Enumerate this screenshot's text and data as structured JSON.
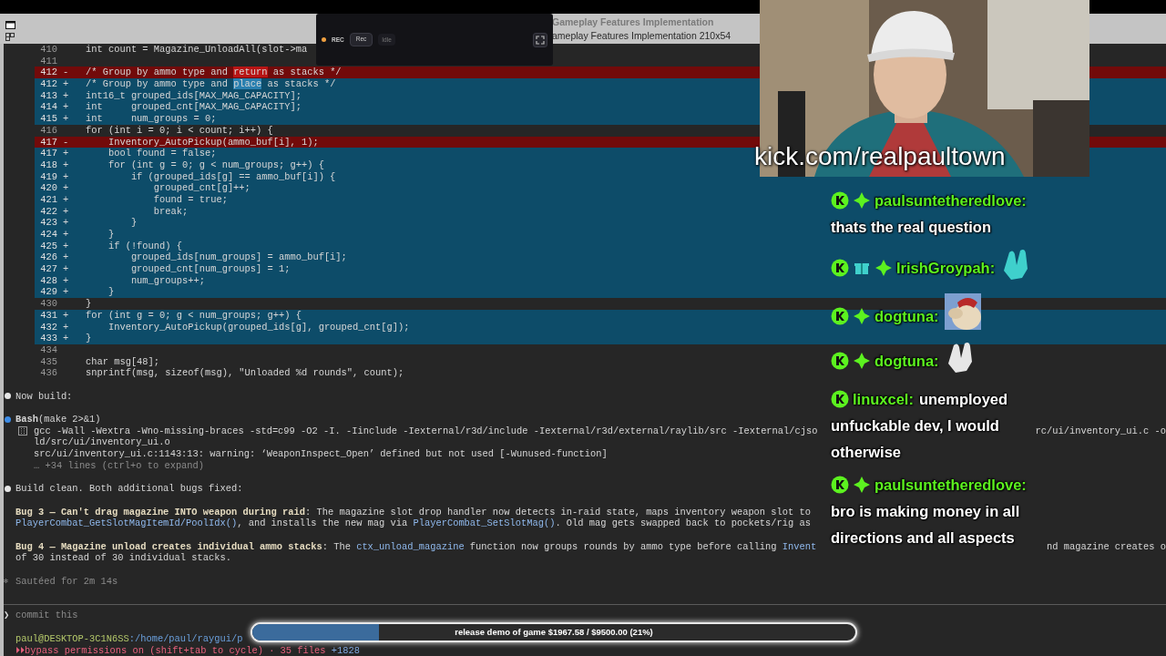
{
  "window": {
    "title_lines": [
      "Gameplay Features Implementation",
      "ameplay Features Implementation 210x54"
    ]
  },
  "recorder": {
    "status": "REC",
    "button": "Rec",
    "state": "Idle"
  },
  "diff": [
    {
      "number": "410",
      "kind": "context",
      "code": "int count = Magazine_UnloadAll(slot->ma"
    },
    {
      "number": "411",
      "kind": "context"
    },
    {
      "number": "412",
      "kind": "removed",
      "sign": "-",
      "segments": [
        {
          "text": "/* Group by ammo type and ",
          "highlight": false
        },
        {
          "text": "return",
          "highlight": true
        },
        {
          "text": " as stacks */",
          "highlight": false
        }
      ]
    },
    {
      "number": "412",
      "kind": "added",
      "sign": "+",
      "segments": [
        {
          "text": "/* Group by ammo type and ",
          "highlight": false
        },
        {
          "text": "place",
          "highlight": true
        },
        {
          "text": " as stacks */",
          "highlight": false
        }
      ]
    },
    {
      "number": "413",
      "kind": "added",
      "sign": "+",
      "code": "int16_t grouped_ids[MAX_MAG_CAPACITY];"
    },
    {
      "number": "414",
      "kind": "added",
      "sign": "+",
      "code": "int     grouped_cnt[MAX_MAG_CAPACITY];"
    },
    {
      "number": "415",
      "kind": "added",
      "sign": "+",
      "code": "int     num_groups = 0;"
    },
    {
      "number": "416",
      "kind": "context",
      "code": "for (int i = 0; i < count; i++) {"
    },
    {
      "number": "417",
      "kind": "removed",
      "sign": "-",
      "code": "    Inventory_AutoPickup(ammo_buf[i], 1);"
    },
    {
      "number": "417",
      "kind": "added",
      "sign": "+",
      "code": "    bool found = false;"
    },
    {
      "number": "418",
      "kind": "added",
      "sign": "+",
      "code": "    for (int g = 0; g < num_groups; g++) {"
    },
    {
      "number": "419",
      "kind": "added",
      "sign": "+",
      "code": "        if (grouped_ids[g] == ammo_buf[i]) {"
    },
    {
      "number": "420",
      "kind": "added",
      "sign": "+",
      "code": "            grouped_cnt[g]++;"
    },
    {
      "number": "421",
      "kind": "added",
      "sign": "+",
      "code": "            found = true;"
    },
    {
      "number": "422",
      "kind": "added",
      "sign": "+",
      "code": "            break;"
    },
    {
      "number": "423",
      "kind": "added",
      "sign": "+",
      "code": "        }"
    },
    {
      "number": "424",
      "kind": "added",
      "sign": "+",
      "code": "    }"
    },
    {
      "number": "425",
      "kind": "added",
      "sign": "+",
      "code": "    if (!found) {"
    },
    {
      "number": "426",
      "kind": "added",
      "sign": "+",
      "code": "        grouped_ids[num_groups] = ammo_buf[i];"
    },
    {
      "number": "427",
      "kind": "added",
      "sign": "+",
      "code": "        grouped_cnt[num_groups] = 1;"
    },
    {
      "number": "428",
      "kind": "added",
      "sign": "+",
      "code": "        num_groups++;"
    },
    {
      "number": "429",
      "kind": "added",
      "sign": "+",
      "code": "    }"
    },
    {
      "number": "430",
      "kind": "context",
      "code": "}"
    },
    {
      "number": "431",
      "kind": "added",
      "sign": "+",
      "code": "for (int g = 0; g < num_groups; g++) {"
    },
    {
      "number": "432",
      "kind": "added",
      "sign": "+",
      "code": "    Inventory_AutoPickup(grouped_ids[g], grouped_cnt[g]);"
    },
    {
      "number": "433",
      "kind": "added",
      "sign": "+",
      "code": "}"
    },
    {
      "number": "434",
      "kind": "context"
    },
    {
      "number": "435",
      "kind": "context",
      "code": "char msg[48];"
    },
    {
      "number": "436",
      "kind": "context",
      "code": "snprintf(msg, sizeof(msg), \"Unloaded %d rounds\", count);"
    }
  ],
  "transcript": [
    {
      "kind": "step",
      "color": "#e6e6e6",
      "text": "Now build:"
    },
    {
      "kind": "tool",
      "color": "#3d8ce6",
      "title": "**Bash**(make 2>&1)",
      "output": [
        {
          "text": "gcc -Wall -Wextra -Wno-missing-braces -std=c99 -O2 -I. -Iinclude -Iexternal/r3d/include -Iexternal/r3d/external/raylib/src -Iexternal/cjso",
          "tail": "rc/ui/inventory_ui.c -o"
        },
        {
          "text": "ld/src/ui/inventory_ui.o"
        },
        {
          "text": "src/ui/inventory_ui.c:1143:13: warning: ‘WeaponInspect_Open’ defined but not used [-Wunused-function]"
        }
      ],
      "collapsed": "… +34 lines (ctrl+o to expand)"
    },
    {
      "kind": "step",
      "color": "#e6e6e6",
      "text": "Build clean. Both additional bugs fixed:"
    },
    {
      "kind": "paragraph",
      "lines": [
        {
          "segments": [
            {
              "text": "Bug 3 — Can't drag magazine INTO weapon during raid",
              "kind": "heading"
            },
            {
              "text": ": The magazine slot drop handler now detects in-raid state, maps inventory weapon slot to",
              "kind": "prose"
            }
          ]
        },
        {
          "segments": [
            {
              "text": "PlayerCombat_GetSlotMagItemId/PoolIdx()",
              "kind": "symbol"
            },
            {
              "text": ", and installs the new mag via ",
              "kind": "prose"
            },
            {
              "text": "PlayerCombat_SetSlotMag()",
              "kind": "symbol"
            },
            {
              "text": ". Old mag gets swapped back to pockets/rig as",
              "kind": "prose"
            }
          ]
        }
      ]
    },
    {
      "kind": "paragraph",
      "lines": [
        {
          "segments": [
            {
              "text": "Bug 4 — Magazine unload creates individual ammo stacks",
              "kind": "heading"
            },
            {
              "text": ": The ",
              "kind": "prose"
            },
            {
              "text": "ctx_unload_magazine",
              "kind": "symbol"
            },
            {
              "text": " function now groups rounds by ammo type before calling ",
              "kind": "prose"
            },
            {
              "text": "Invent",
              "kind": "symbol"
            }
          ],
          "tail": "nd magazine creates o"
        },
        {
          "segments": [
            {
              "text": "of 30 instead of 30 individual stacks.",
              "kind": "prose"
            }
          ]
        }
      ]
    },
    {
      "kind": "timer",
      "glyph": "✻",
      "text": "Sautéed for 2m 14s"
    }
  ],
  "prompt": {
    "glyph": "❯",
    "text": "commit this"
  },
  "status": {
    "user": "paul@DESKTOP-3C1N6SS",
    "path": ":/home/paul/raygui/p",
    "glyph": "⏵⏵",
    "mode": "bypass permissions on",
    "hint": " (shift+tab to cycle) · 35 files ",
    "added": "+1828"
  },
  "webcam": {
    "kind": "picture",
    "caption": "kick.com/realpaultown"
  },
  "chat": [
    {
      "badges": [
        {
          "kind": "kick"
        },
        {
          "kind": "sparkle"
        }
      ],
      "user": "paulsuntetheredlove:",
      "lines": [
        "thats the real question"
      ],
      "inline_first": false
    },
    {
      "badges": [
        {
          "kind": "kick"
        },
        {
          "kind": "gift"
        },
        {
          "kind": "sparkle"
        }
      ],
      "user": "IrishGroypah:",
      "emote": {
        "kind": "hands",
        "color": "#3fd0cc"
      }
    },
    {
      "badges": [
        {
          "kind": "kick"
        },
        {
          "kind": "sparkle"
        }
      ],
      "user": "dogtuna:",
      "emote": {
        "kind": "picture"
      }
    },
    {
      "badges": [
        {
          "kind": "kick"
        },
        {
          "kind": "sparkle"
        }
      ],
      "user": "dogtuna:",
      "emote": {
        "kind": "hands",
        "color": "#e6e6e6"
      }
    },
    {
      "badges": [
        {
          "kind": "kick"
        }
      ],
      "user": "linuxcel:",
      "lines": [
        "unemployed",
        "unfuckable dev, I would",
        "otherwise"
      ],
      "inline_first": true
    },
    {
      "badges": [
        {
          "kind": "kick"
        },
        {
          "kind": "sparkle"
        }
      ],
      "user": "paulsuntetheredlove:",
      "lines": [
        "bro is making money in all",
        "directions and all aspects"
      ],
      "inline_first": false
    }
  ],
  "goal": {
    "label": "release demo of game $1967.58 / $9500.00 (21%)",
    "level": 0.21
  }
}
